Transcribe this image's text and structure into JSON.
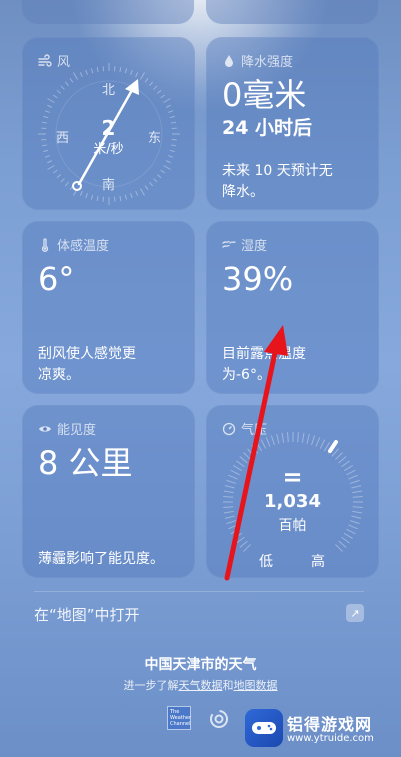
{
  "wind": {
    "title": "风",
    "north": "北",
    "south": "南",
    "east": "东",
    "west": "西",
    "speed": "2",
    "unit": "米/秒"
  },
  "precip": {
    "title": "降水强度",
    "value": "0毫米",
    "period": "24 小时后",
    "desc_line1": "未来 10 天预计无",
    "desc_line2": "降水。"
  },
  "feels": {
    "title": "体感温度",
    "value": "6°",
    "desc_line1": "刮风使人感觉更",
    "desc_line2": "凉爽。"
  },
  "humidity": {
    "title": "湿度",
    "value": "39%",
    "desc_line1": "目前露点温度",
    "desc_line2": "为-6°。"
  },
  "visibility": {
    "title": "能见度",
    "value": "8 公里",
    "desc": "薄霾影响了能见度。"
  },
  "pressure": {
    "title": "气压",
    "symbol": "=",
    "value": "1,034",
    "unit": "百帕",
    "low": "低",
    "high": "高"
  },
  "maps_link": {
    "label": "在“地图”中打开"
  },
  "footer": {
    "title": "中国天津市的天气",
    "prefix": "进一步了解",
    "link1": "天气数据",
    "middle": "和",
    "link2": "地图数据",
    "twc_logo_text": "The Weather Channel"
  },
  "watermark": {
    "title": "铝得游戏网",
    "url": "www.ytruide.com"
  },
  "annotation_arrow_color": "#e8141c"
}
